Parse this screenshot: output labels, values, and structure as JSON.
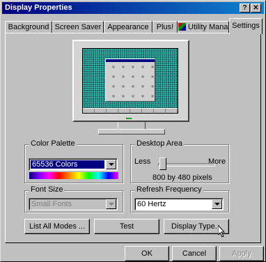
{
  "window": {
    "title": "Display Properties",
    "help_button": "?",
    "close_button": "✕"
  },
  "tabs": [
    {
      "label": "Background"
    },
    {
      "label": "Screen Saver"
    },
    {
      "label": "Appearance"
    },
    {
      "label": "Plus!"
    },
    {
      "label": "Utility Manager"
    },
    {
      "label": "Settings"
    }
  ],
  "active_tab": "Settings",
  "color_palette": {
    "label": "Color Palette",
    "value": "65536 Colors"
  },
  "desktop_area": {
    "label": "Desktop Area",
    "less": "Less",
    "more": "More",
    "resolution": "800 by 480 pixels"
  },
  "font_size": {
    "label": "Font Size",
    "value": "Small Fonts"
  },
  "refresh_frequency": {
    "label": "Refresh Frequency",
    "value": "60 Hertz"
  },
  "buttons": {
    "list_all_modes": "List All Modes ...",
    "test": "Test",
    "display_type": "Display Type..."
  },
  "footer": {
    "ok": "OK",
    "cancel": "Cancel",
    "apply": "Apply"
  },
  "icons": [
    "help-icon",
    "close-icon",
    "utility-manager-icon",
    "monitor-icon",
    "mouse-cursor-icon"
  ]
}
